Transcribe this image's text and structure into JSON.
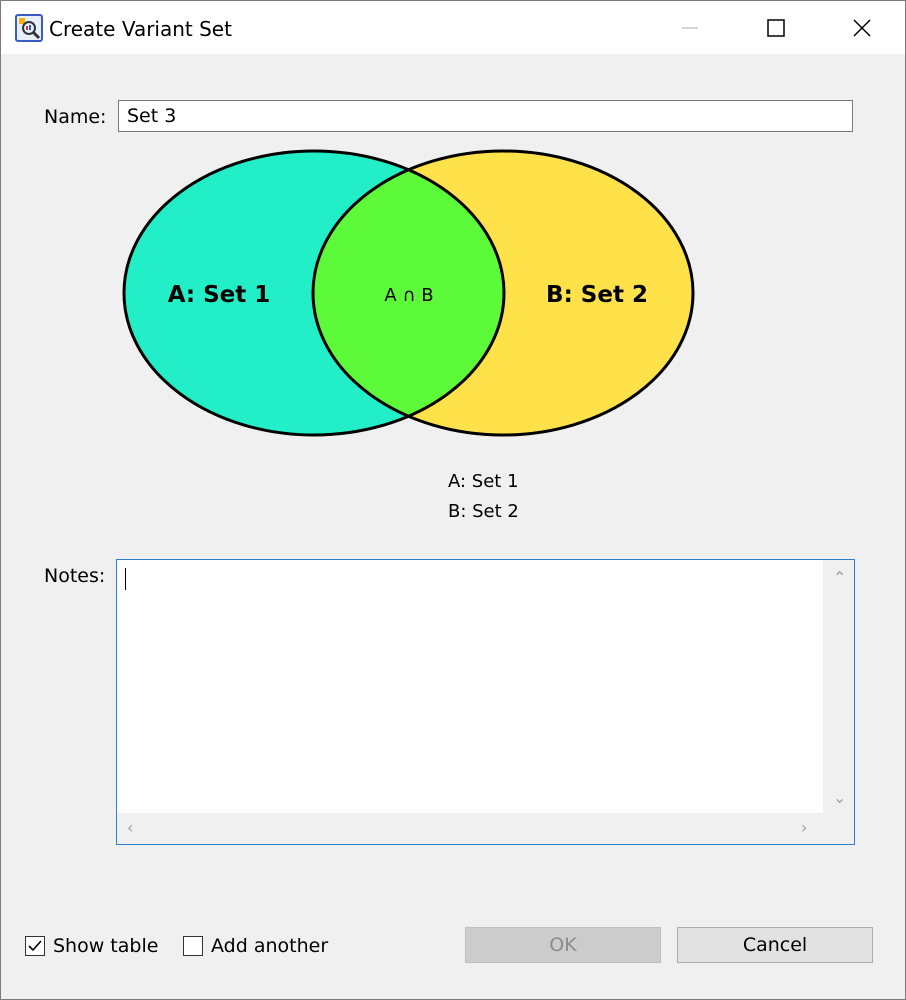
{
  "window": {
    "title": "Create Variant Set"
  },
  "form": {
    "name_label": "Name:",
    "name_value": "Set 3",
    "notes_label": "Notes:",
    "notes_value": ""
  },
  "venn": {
    "set_a_label": "A: Set 1",
    "set_b_label": "B: Set 2",
    "intersection_label": "A ∩ B",
    "colors": {
      "a_only": "#22efc8",
      "b_only": "#ffe14a",
      "intersection": "#5cfa38"
    }
  },
  "legend": {
    "line_a": "A: Set 1",
    "line_b": "B: Set 2"
  },
  "options": {
    "show_table_label": "Show table",
    "show_table_checked": true,
    "add_another_label": "Add another",
    "add_another_checked": false
  },
  "buttons": {
    "ok_label": "OK",
    "cancel_label": "Cancel"
  },
  "icons": {
    "app": "variant-set-icon",
    "minimize": "minimize-icon",
    "maximize": "maximize-icon",
    "close": "close-icon",
    "check": "check-icon"
  }
}
